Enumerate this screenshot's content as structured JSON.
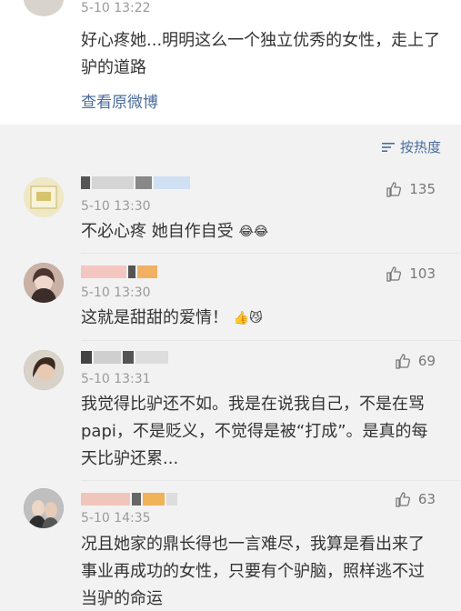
{
  "top_post": {
    "time": "5-10 13:22",
    "text": "好心疼她...明明这么一个独立优秀的女性，走上了驴的道路",
    "view_original": "查看原微博"
  },
  "sort": {
    "label": "按热度"
  },
  "comments": [
    {
      "time": "5-10 13:30",
      "text": "不必心疼 她自作自受",
      "likes": "135",
      "emoji": "😂😂"
    },
    {
      "time": "5-10 13:30",
      "text": "这就是甜甜的爱情！",
      "likes": "103",
      "emoji": "👍😼"
    },
    {
      "time": "5-10 13:31",
      "text": "我觉得比驴还不如。我是在说我自己，不是在骂papi，不是贬义，不觉得是被“打成”。是真的每天比驴还累...",
      "likes": "69"
    },
    {
      "time": "5-10 14:35",
      "text": "况且她家的鼎长得也一言难尽，我算是看出来了事业再成功的女性，只要有个驴脑，照样逃不过当驴的命运",
      "likes": "63"
    }
  ],
  "colors": {
    "link": "#4b6c9c",
    "meta": "#9a9a9a",
    "text": "#333333",
    "background": "#f2f2f2"
  }
}
